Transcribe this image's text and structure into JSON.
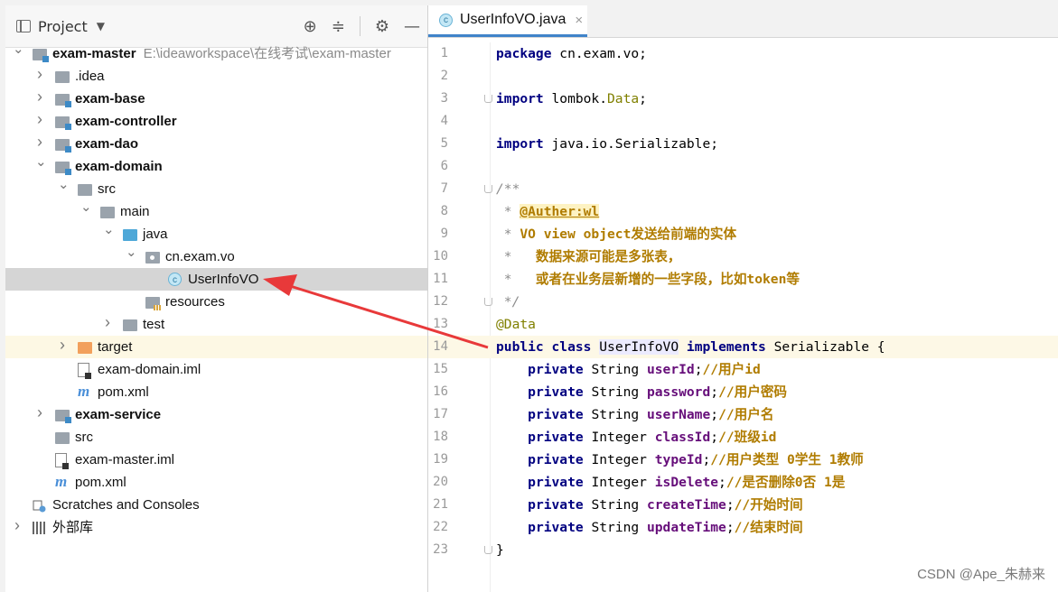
{
  "project_panel": {
    "title": "Project",
    "header_icons": [
      "locate-icon",
      "collapse-all-icon",
      "settings-icon",
      "hide-icon"
    ]
  },
  "tree": [
    {
      "label": "exam-master",
      "suffix": "E:\\ideaworkspace\\在线考试\\exam-master",
      "expanded": true,
      "bold": true,
      "icon": "module-folder-icon"
    },
    {
      "label": ".idea",
      "expanded": false,
      "icon": "folder-icon"
    },
    {
      "label": "exam-base",
      "expanded": false,
      "bold": true,
      "icon": "module-folder-icon"
    },
    {
      "label": "exam-controller",
      "expanded": false,
      "bold": true,
      "icon": "module-folder-icon"
    },
    {
      "label": "exam-dao",
      "expanded": false,
      "bold": true,
      "icon": "module-folder-icon"
    },
    {
      "label": "exam-domain",
      "expanded": true,
      "bold": true,
      "icon": "module-folder-icon"
    },
    {
      "label": "src",
      "expanded": true,
      "icon": "folder-icon"
    },
    {
      "label": "main",
      "expanded": true,
      "icon": "folder-icon"
    },
    {
      "label": "java",
      "expanded": true,
      "icon": "source-folder-icon"
    },
    {
      "label": "cn.exam.vo",
      "expanded": true,
      "icon": "package-icon"
    },
    {
      "label": "UserInfoVO",
      "icon": "class-icon",
      "selected": true
    },
    {
      "label": "resources",
      "icon": "resources-folder-icon"
    },
    {
      "label": "test",
      "expanded": false,
      "icon": "folder-icon"
    },
    {
      "label": "target",
      "expanded": false,
      "icon": "excluded-folder-icon"
    },
    {
      "label": "exam-domain.iml",
      "icon": "iml-file-icon"
    },
    {
      "label": "pom.xml",
      "icon": "maven-icon"
    },
    {
      "label": "exam-service",
      "expanded": false,
      "bold": true,
      "icon": "module-folder-icon"
    },
    {
      "label": "src",
      "icon": "folder-icon"
    },
    {
      "label": "exam-master.iml",
      "icon": "iml-file-icon"
    },
    {
      "label": "pom.xml",
      "icon": "maven-icon"
    },
    {
      "label": "Scratches and Consoles",
      "icon": "scratches-icon"
    },
    {
      "label": "外部库",
      "expanded": false,
      "icon": "library-icon"
    }
  ],
  "editor": {
    "tab_label": "UserInfoVO.java",
    "current_line": 14,
    "lines": [
      {
        "n": "1",
        "t": "package cn.exam.vo;"
      },
      {
        "n": "2",
        "t": ""
      },
      {
        "n": "3",
        "t": "import lombok.Data;"
      },
      {
        "n": "4",
        "t": ""
      },
      {
        "n": "5",
        "t": "import java.io.Serializable;"
      },
      {
        "n": "6",
        "t": ""
      },
      {
        "n": "7",
        "t": "/**"
      },
      {
        "n": "8",
        "t": " * @Auther:wl"
      },
      {
        "n": "9",
        "t": " * VO view object发送给前端的实体"
      },
      {
        "n": "10",
        "t": " *   数据来源可能是多张表，"
      },
      {
        "n": "11",
        "t": " *   或者在业务层新增的一些字段，比如token等"
      },
      {
        "n": "12",
        "t": " */"
      },
      {
        "n": "13",
        "t": "@Data"
      },
      {
        "n": "14",
        "t": "public class UserInfoVO implements Serializable {"
      },
      {
        "n": "15",
        "t": "    private String userId;//用户id"
      },
      {
        "n": "16",
        "t": "    private String password;//用户密码"
      },
      {
        "n": "17",
        "t": "    private String userName;//用户名"
      },
      {
        "n": "18",
        "t": "    private Integer classId;//班级id"
      },
      {
        "n": "19",
        "t": "    private Integer typeId;//用户类型 0学生 1教师"
      },
      {
        "n": "20",
        "t": "    private Integer isDelete;//是否删除0否 1是"
      },
      {
        "n": "21",
        "t": "    private String createTime;//开始时间"
      },
      {
        "n": "22",
        "t": "    private String updateTime;//结束时间"
      },
      {
        "n": "23",
        "t": "}"
      }
    ]
  },
  "watermark": "CSDN @Ape_朱赫来",
  "colors": {
    "accent": "#4083c9",
    "arrow": "#e8393a",
    "selection": "#d5d5d5"
  }
}
